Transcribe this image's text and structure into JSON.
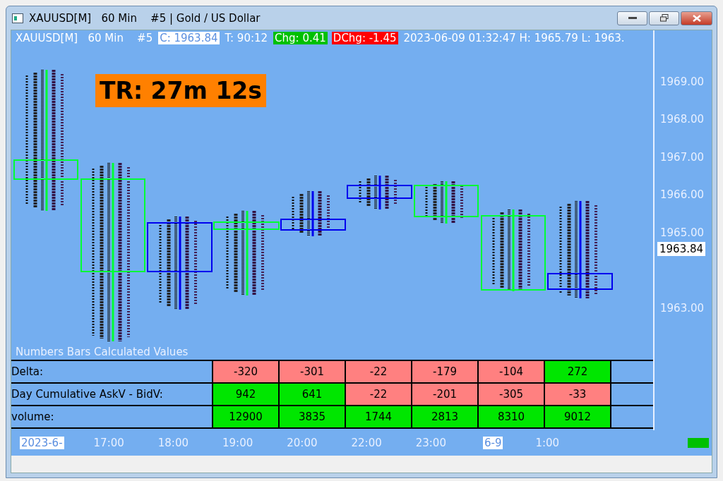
{
  "window": {
    "title": "XAUUSD[M]   60 Min    #5 | Gold / US Dollar"
  },
  "info_line": [
    {
      "kind": "plain",
      "text": "XAUUSD[M]   60 Min    #5"
    },
    {
      "kind": "highlight",
      "text": "C: 1963.84"
    },
    {
      "kind": "plain",
      "text": "T: 90:12"
    },
    {
      "kind": "up",
      "text": "Chg: 0.41"
    },
    {
      "kind": "down",
      "text": "DChg: -1.45"
    },
    {
      "kind": "plain",
      "text": "2023-06-09 01:32:47 H: 1965.79 L: 1963."
    }
  ],
  "timer": "TR: 27m 12s",
  "price_axis": [
    {
      "kind": "tick",
      "label": "1969.00"
    },
    {
      "kind": "tick",
      "label": "1968.00"
    },
    {
      "kind": "tick",
      "label": "1967.00"
    },
    {
      "kind": "tick",
      "label": "1966.00"
    },
    {
      "kind": "tick",
      "label": "1965.00"
    },
    {
      "kind": "current",
      "label": "1963.84"
    },
    {
      "kind": "tick",
      "label": "1963.00"
    }
  ],
  "table": {
    "title": "Numbers Bars Calculated Values",
    "rows": [
      {
        "label": "Delta:",
        "cells": [
          {
            "text": "-320",
            "color": "#ff8080"
          },
          {
            "text": "-301",
            "color": "#ff8080"
          },
          {
            "text": "-22",
            "color": "#ff8080"
          },
          {
            "text": "-179",
            "color": "#ff8080"
          },
          {
            "text": "-104",
            "color": "#ff8080"
          },
          {
            "text": "272",
            "color": "#00e600"
          }
        ]
      },
      {
        "label": "Day Cumulative AskV - BidV:",
        "cells": [
          {
            "text": "942",
            "color": "#00e600"
          },
          {
            "text": "641",
            "color": "#00e600"
          },
          {
            "text": "-22",
            "color": "#ff8080"
          },
          {
            "text": "-201",
            "color": "#ff8080"
          },
          {
            "text": "-305",
            "color": "#ff8080"
          },
          {
            "text": "-33",
            "color": "#ff8080"
          }
        ]
      },
      {
        "label": "volume:",
        "cells": [
          {
            "text": "12900",
            "color": "#00e600"
          },
          {
            "text": "3835",
            "color": "#00e600"
          },
          {
            "text": "1744",
            "color": "#00e600"
          },
          {
            "text": "2813",
            "color": "#00e600"
          },
          {
            "text": "8310",
            "color": "#00e600"
          },
          {
            "text": "9012",
            "color": "#00e600"
          }
        ]
      }
    ]
  },
  "time_axis": [
    {
      "label": "2023-6-",
      "selected": true
    },
    {
      "label": "17:00",
      "selected": false
    },
    {
      "label": "18:00",
      "selected": false
    },
    {
      "label": "19:00",
      "selected": false
    },
    {
      "label": "20:00",
      "selected": false
    },
    {
      "label": "22:00",
      "selected": false
    },
    {
      "label": "23:00",
      "selected": false
    },
    {
      "label": "6-9",
      "selected": true
    },
    {
      "label": "1:00",
      "selected": false
    }
  ]
}
